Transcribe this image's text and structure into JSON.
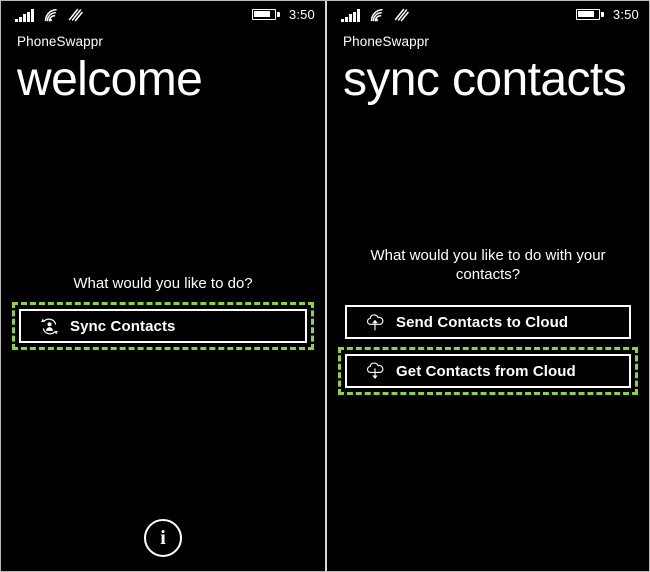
{
  "statusbar": {
    "signal_icon": "signal-bars-icon",
    "wifi_icon": "wifi-icon",
    "data-connection_icon": "cellular-data-waves-icon",
    "battery_icon": "battery-icon",
    "time": "3:50"
  },
  "screens": [
    {
      "app_name": "PhoneSwappr",
      "title": "welcome",
      "prompt": "What would you like to do?",
      "buttons": [
        {
          "label": "Sync Contacts",
          "icon": "sync-contact-icon",
          "highlighted": true
        }
      ],
      "appbar": {
        "info_label": "i",
        "info_icon": "info-icon"
      }
    },
    {
      "app_name": "PhoneSwappr",
      "title": "sync contacts",
      "prompt": "What would you like to do with your contacts?",
      "buttons": [
        {
          "label": "Send Contacts to Cloud",
          "icon": "cloud-upload-icon",
          "highlighted": false
        },
        {
          "label": "Get Contacts from Cloud",
          "icon": "cloud-download-icon",
          "highlighted": true
        }
      ]
    }
  ],
  "colors": {
    "background": "#000000",
    "foreground": "#ffffff",
    "highlight": "#8fd140",
    "divider": "#d8d8d8"
  }
}
